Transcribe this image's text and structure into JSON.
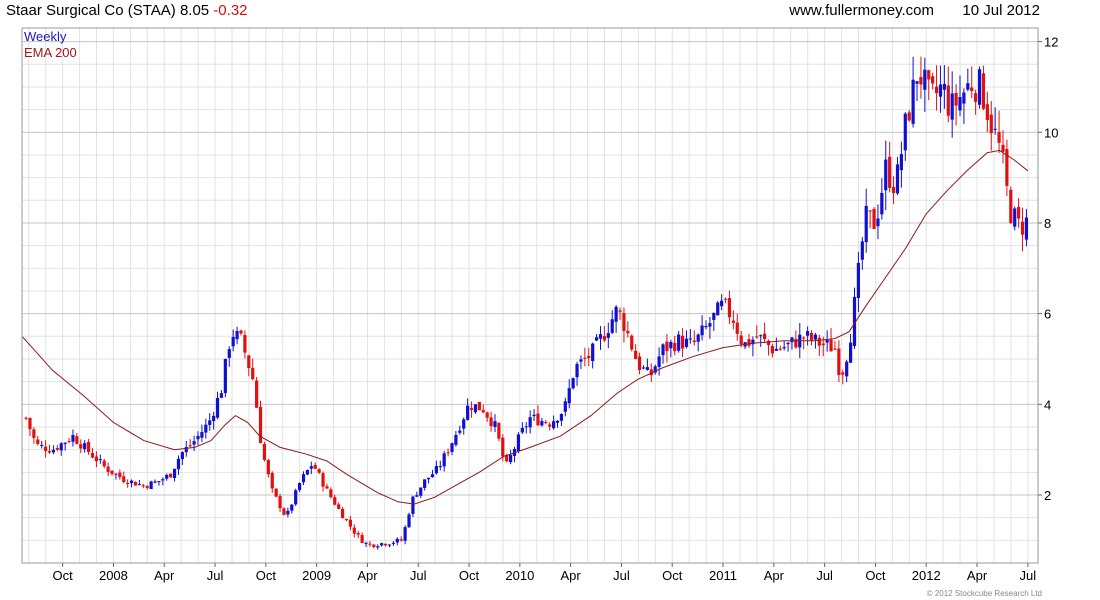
{
  "header": {
    "title": "Staar Surgical Co (STAA) 8.05",
    "change": "-0.32",
    "site": "www.fullermoney.com",
    "date": "10 Jul 2012"
  },
  "legend": {
    "period": "Weekly",
    "indicator": "EMA 200"
  },
  "footer": {
    "copyright": "© 2012 Stockcube Research Ltd"
  },
  "colors": {
    "up": "#1010d0",
    "down": "#e01010",
    "ema": "#8b1a1a",
    "grid": "#e2e2e2",
    "grid_major": "#c4c4c4"
  },
  "chart_data": {
    "type": "candlestick",
    "y_axis": {
      "ticks": [
        2,
        4,
        6,
        8,
        10,
        12
      ],
      "ylim": [
        0.5,
        12.3
      ],
      "position": "right"
    },
    "x_axis": {
      "ticks": [
        {
          "label": "Oct",
          "x": 2007.75
        },
        {
          "label": "2008",
          "x": 2008.0
        },
        {
          "label": "Apr",
          "x": 2008.25
        },
        {
          "label": "Jul",
          "x": 2008.5
        },
        {
          "label": "Oct",
          "x": 2008.75
        },
        {
          "label": "2009",
          "x": 2009.0
        },
        {
          "label": "Apr",
          "x": 2009.25
        },
        {
          "label": "Jul",
          "x": 2009.5
        },
        {
          "label": "Oct",
          "x": 2009.75
        },
        {
          "label": "2010",
          "x": 2010.0
        },
        {
          "label": "Apr",
          "x": 2010.25
        },
        {
          "label": "Jul",
          "x": 2010.5
        },
        {
          "label": "Oct",
          "x": 2010.75
        },
        {
          "label": "2011",
          "x": 2011.0
        },
        {
          "label": "Apr",
          "x": 2011.25
        },
        {
          "label": "Jul",
          "x": 2011.5
        },
        {
          "label": "Oct",
          "x": 2011.75
        },
        {
          "label": "2012",
          "x": 2012.0
        },
        {
          "label": "Apr",
          "x": 2012.25
        },
        {
          "label": "Jul",
          "x": 2012.5
        }
      ],
      "xlim": [
        2007.55,
        2012.55
      ]
    },
    "price_anchors": [
      [
        2007.57,
        3.7
      ],
      [
        2007.62,
        3.1
      ],
      [
        2007.7,
        3.0
      ],
      [
        2007.8,
        3.3
      ],
      [
        2007.88,
        2.95
      ],
      [
        2007.96,
        2.6
      ],
      [
        2008.05,
        2.35
      ],
      [
        2008.15,
        2.2
      ],
      [
        2008.22,
        2.3
      ],
      [
        2008.28,
        2.45
      ],
      [
        2008.33,
        2.9
      ],
      [
        2008.4,
        3.2
      ],
      [
        2008.47,
        3.6
      ],
      [
        2008.53,
        4.3
      ],
      [
        2008.58,
        5.6
      ],
      [
        2008.63,
        5.4
      ],
      [
        2008.69,
        4.5
      ],
      [
        2008.73,
        3.0
      ],
      [
        2008.78,
        2.1
      ],
      [
        2008.85,
        1.5
      ],
      [
        2008.92,
        2.3
      ],
      [
        2008.98,
        2.7
      ],
      [
        2009.05,
        2.1
      ],
      [
        2009.12,
        1.6
      ],
      [
        2009.2,
        1.1
      ],
      [
        2009.25,
        0.9
      ],
      [
        2009.35,
        0.95
      ],
      [
        2009.42,
        1.0
      ],
      [
        2009.47,
        1.9
      ],
      [
        2009.53,
        2.3
      ],
      [
        2009.6,
        2.6
      ],
      [
        2009.68,
        3.3
      ],
      [
        2009.75,
        4.0
      ],
      [
        2009.82,
        3.9
      ],
      [
        2009.88,
        3.5
      ],
      [
        2009.93,
        2.6
      ],
      [
        2010.0,
        3.3
      ],
      [
        2010.05,
        3.7
      ],
      [
        2010.15,
        3.6
      ],
      [
        2010.22,
        3.9
      ],
      [
        2010.27,
        4.8
      ],
      [
        2010.35,
        5.1
      ],
      [
        2010.42,
        5.6
      ],
      [
        2010.48,
        6.1
      ],
      [
        2010.52,
        5.7
      ],
      [
        2010.58,
        4.9
      ],
      [
        2010.64,
        4.6
      ],
      [
        2010.7,
        5.2
      ],
      [
        2010.78,
        5.4
      ],
      [
        2010.85,
        5.3
      ],
      [
        2010.92,
        5.7
      ],
      [
        2011.0,
        6.2
      ],
      [
        2011.05,
        5.9
      ],
      [
        2011.1,
        5.3
      ],
      [
        2011.17,
        5.5
      ],
      [
        2011.25,
        5.2
      ],
      [
        2011.32,
        5.3
      ],
      [
        2011.4,
        5.5
      ],
      [
        2011.45,
        5.4
      ],
      [
        2011.5,
        5.3
      ],
      [
        2011.55,
        5.25
      ],
      [
        2011.58,
        4.6
      ],
      [
        2011.62,
        5.3
      ],
      [
        2011.65,
        6.3
      ],
      [
        2011.7,
        8.1
      ],
      [
        2011.75,
        8.0
      ],
      [
        2011.8,
        9.2
      ],
      [
        2011.85,
        8.8
      ],
      [
        2011.9,
        10.2
      ],
      [
        2011.96,
        11.4
      ],
      [
        2012.02,
        10.7
      ],
      [
        2012.08,
        11.0
      ],
      [
        2012.12,
        10.5
      ],
      [
        2012.17,
        10.8
      ],
      [
        2012.22,
        11.1
      ],
      [
        2012.27,
        11.0
      ],
      [
        2012.32,
        10.2
      ],
      [
        2012.37,
        9.5
      ],
      [
        2012.41,
        8.3
      ],
      [
        2012.46,
        7.9
      ],
      [
        2012.5,
        8.05
      ]
    ],
    "ema_200": [
      [
        2007.55,
        5.5
      ],
      [
        2007.7,
        4.75
      ],
      [
        2007.85,
        4.2
      ],
      [
        2008.0,
        3.6
      ],
      [
        2008.15,
        3.2
      ],
      [
        2008.3,
        3.0
      ],
      [
        2008.4,
        3.05
      ],
      [
        2008.48,
        3.2
      ],
      [
        2008.55,
        3.55
      ],
      [
        2008.6,
        3.75
      ],
      [
        2008.66,
        3.6
      ],
      [
        2008.72,
        3.3
      ],
      [
        2008.82,
        3.05
      ],
      [
        2008.95,
        2.9
      ],
      [
        2009.05,
        2.75
      ],
      [
        2009.15,
        2.45
      ],
      [
        2009.3,
        2.05
      ],
      [
        2009.4,
        1.85
      ],
      [
        2009.48,
        1.8
      ],
      [
        2009.58,
        1.95
      ],
      [
        2009.68,
        2.2
      ],
      [
        2009.8,
        2.5
      ],
      [
        2009.92,
        2.85
      ],
      [
        2010.05,
        3.05
      ],
      [
        2010.2,
        3.3
      ],
      [
        2010.35,
        3.75
      ],
      [
        2010.48,
        4.25
      ],
      [
        2010.58,
        4.55
      ],
      [
        2010.7,
        4.8
      ],
      [
        2010.85,
        5.05
      ],
      [
        2011.0,
        5.25
      ],
      [
        2011.15,
        5.35
      ],
      [
        2011.3,
        5.4
      ],
      [
        2011.45,
        5.4
      ],
      [
        2011.55,
        5.45
      ],
      [
        2011.62,
        5.6
      ],
      [
        2011.7,
        6.15
      ],
      [
        2011.8,
        6.8
      ],
      [
        2011.9,
        7.45
      ],
      [
        2012.0,
        8.2
      ],
      [
        2012.1,
        8.7
      ],
      [
        2012.2,
        9.15
      ],
      [
        2012.3,
        9.55
      ],
      [
        2012.36,
        9.6
      ],
      [
        2012.43,
        9.4
      ],
      [
        2012.5,
        9.15
      ]
    ]
  }
}
